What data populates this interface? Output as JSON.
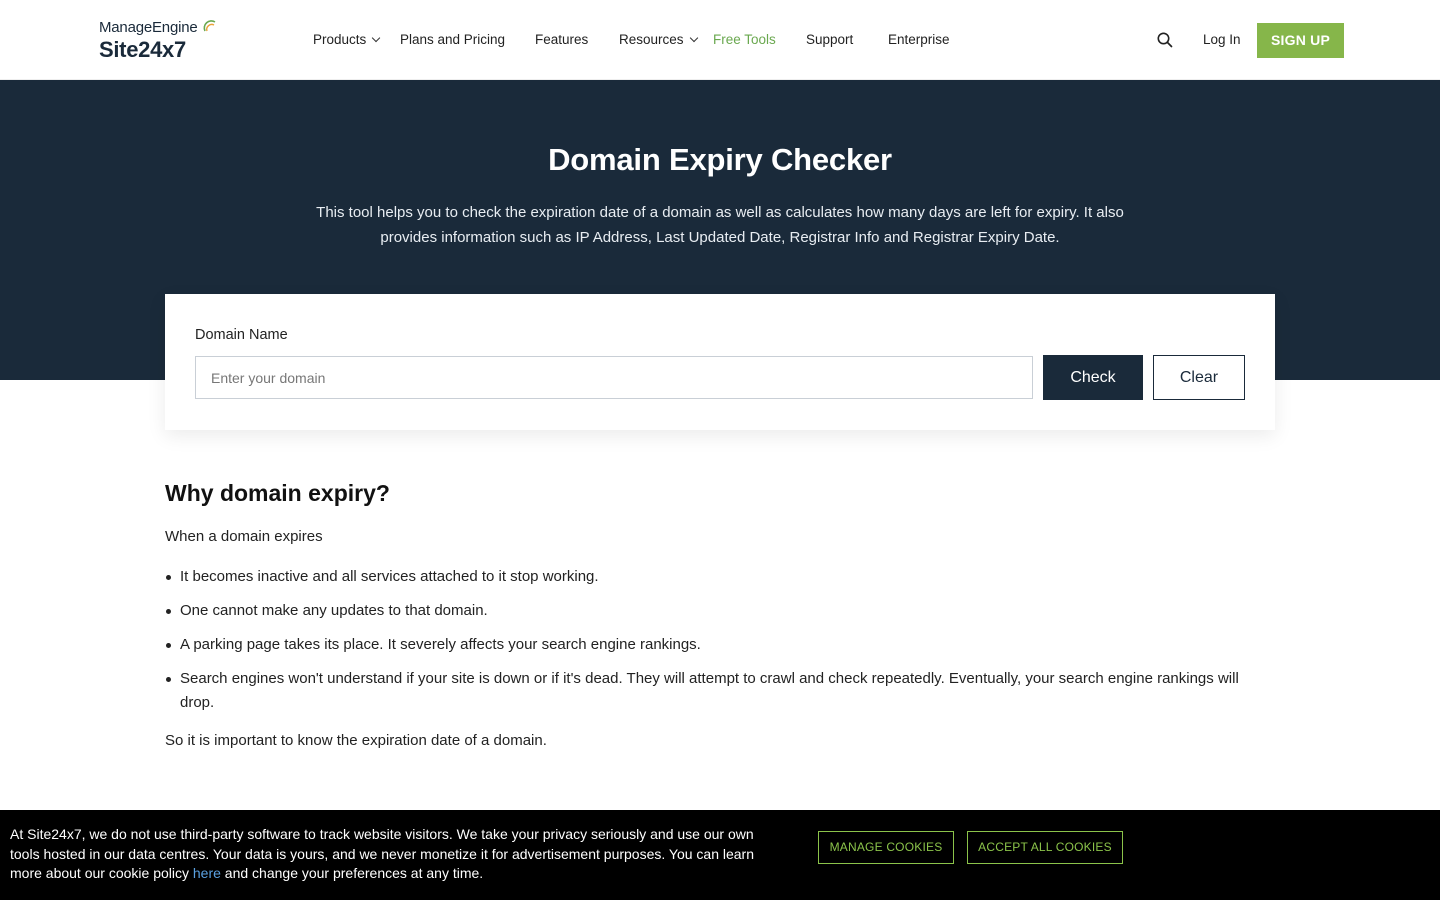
{
  "header": {
    "logo_top": "ManageEngine",
    "logo_bottom": "Site24x7",
    "nav": [
      {
        "label": "Products",
        "has_dropdown": true
      },
      {
        "label": "Plans and Pricing",
        "has_dropdown": false
      },
      {
        "label": "Features",
        "has_dropdown": false
      },
      {
        "label": "Resources",
        "has_dropdown": true
      },
      {
        "label": "Free Tools",
        "has_dropdown": false,
        "active": true
      },
      {
        "label": "Support",
        "has_dropdown": false
      },
      {
        "label": "Enterprise",
        "has_dropdown": false
      }
    ],
    "search_icon": "search-icon",
    "login_label": "Log In",
    "signup_label": "SIGN UP"
  },
  "hero": {
    "title": "Domain Expiry Checker",
    "description": "This tool helps you to check the expiration date of a domain as well as calculates how many days are left for expiry. It also provides information such as IP Address, Last Updated Date, Registrar Info and Registrar Expiry Date."
  },
  "form": {
    "label": "Domain Name",
    "placeholder": "Enter your domain",
    "value": "",
    "check_label": "Check",
    "clear_label": "Clear"
  },
  "content": {
    "heading": "Why domain expiry?",
    "intro": "When a domain expires",
    "bullets": [
      "It becomes inactive and all services attached to it stop working.",
      "One cannot make any updates to that domain.",
      "A parking page takes its place. It severely affects your search engine rankings.",
      "Search engines won't understand if your site is down or if it's dead. They will attempt to crawl and check repeatedly. Eventually, your search engine rankings will drop."
    ],
    "outro": "So it is important to know the expiration date of a domain."
  },
  "cookie": {
    "text_before": "At Site24x7, we do not use third-party software to track website visitors. We take your privacy seriously and use our own tools hosted in our data centres. Your data is yours, and we never monetize it for advertisement purposes. You can learn more about our cookie policy ",
    "link_label": "here",
    "text_after": " and change your preferences at any time.",
    "manage_label": "MANAGE COOKIES",
    "accept_label": "ACCEPT ALL COOKIES"
  },
  "colors": {
    "brand_dark": "#1a2a3a",
    "accent_green": "#86b64a",
    "link_blue": "#5aa0e0"
  }
}
